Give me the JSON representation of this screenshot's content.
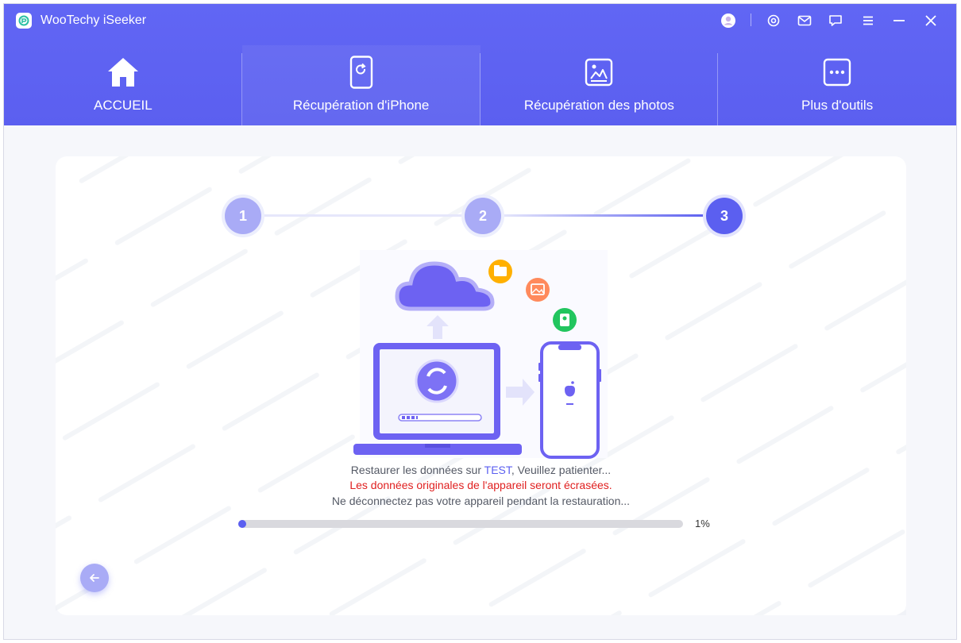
{
  "app": {
    "title": "WooTechy iSeeker",
    "logo_icon": "app-logo-icon"
  },
  "window_controls": [
    {
      "name": "account-icon"
    },
    {
      "name": "settings-icon"
    },
    {
      "name": "mail-icon"
    },
    {
      "name": "feedback-icon"
    },
    {
      "name": "menu-icon"
    },
    {
      "name": "minimize-icon"
    },
    {
      "name": "close-icon"
    }
  ],
  "tabs": [
    {
      "label": "ACCUEIL",
      "icon": "home-icon",
      "active": false
    },
    {
      "label": "Récupération d'iPhone",
      "icon": "iphone-recovery-icon",
      "active": true
    },
    {
      "label": "Récupération des photos",
      "icon": "photo-recovery-icon",
      "active": false
    },
    {
      "label": "Plus d'outils",
      "icon": "more-tools-icon",
      "active": false
    }
  ],
  "stepper": {
    "steps": [
      "1",
      "2",
      "3"
    ],
    "current": 3
  },
  "status": {
    "line1_prefix": "Restaurer les données sur ",
    "device_name": "TEST",
    "line1_suffix": ", Veuillez patienter...",
    "warning": "Les données originales de l'appareil seront écrasées.",
    "notice": "Ne déconnectez pas votre appareil pendant la restauration..."
  },
  "progress": {
    "percent": 1,
    "label": "1%"
  },
  "colors": {
    "accent": "#5b5ff0",
    "warning": "#e02020",
    "step_done": "#a9abf6"
  }
}
